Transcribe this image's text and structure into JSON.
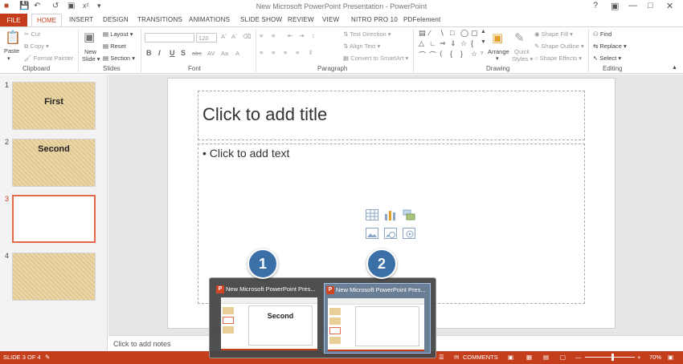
{
  "window": {
    "title": "New Microsoft PowerPoint Presentation - PowerPoint"
  },
  "tabs": [
    "FILE",
    "HOME",
    "INSERT",
    "DESIGN",
    "TRANSITIONS",
    "ANIMATIONS",
    "SLIDE SHOW",
    "REVIEW",
    "VIEW",
    "NITRO PRO 10",
    "PDFelement"
  ],
  "ribbon": {
    "clipboard": {
      "paste": "Paste",
      "cut": "Cut",
      "copy": "Copy",
      "format_painter": "Format Painter",
      "label": "Clipboard"
    },
    "slides": {
      "new_slide_1": "New",
      "new_slide_2": "Slide",
      "layout": "Layout",
      "reset": "Reset",
      "section": "Section",
      "label": "Slides"
    },
    "font": {
      "size": "120",
      "label": "Font",
      "bold": "B",
      "italic": "I",
      "underline": "U",
      "strike": "S",
      "abc": "abc"
    },
    "paragraph": {
      "text_direction": "Text Direction",
      "align_text": "Align Text",
      "convert_smartart": "Convert to SmartArt",
      "label": "Paragraph"
    },
    "drawing": {
      "arrange": "Arrange",
      "quick_styles_1": "Quick",
      "quick_styles_2": "Styles",
      "shape_fill": "Shape Fill",
      "shape_outline": "Shape Outline",
      "shape_effects": "Shape Effects",
      "label": "Drawing"
    },
    "editing": {
      "find": "Find",
      "replace": "Replace",
      "select": "Select",
      "label": "Editing"
    }
  },
  "thumbnails": [
    {
      "num": "1",
      "title": "First"
    },
    {
      "num": "2",
      "title": "Second"
    },
    {
      "num": "3",
      "title": ""
    },
    {
      "num": "4",
      "title": ""
    }
  ],
  "slide": {
    "title_placeholder": "Click to add title",
    "body_placeholder": "• Click to add text"
  },
  "notes_placeholder": "Click to add notes",
  "status": {
    "slide_count": "SLIDE 3 OF 4",
    "comments": "COMMENTS",
    "zoom": "70%"
  },
  "taskbar_preview": {
    "windows": [
      {
        "title": "New Microsoft PowerPoint Pres...",
        "slide_title": "Second",
        "badge": "1"
      },
      {
        "title": "New Microsoft PowerPoint Pres...",
        "slide_title": "",
        "badge": "2"
      }
    ]
  },
  "colors": {
    "accent": "#c43e1c",
    "badge": "#3a6fa8",
    "thumb": "#e8cf98",
    "selected_border": "#e2694a"
  }
}
